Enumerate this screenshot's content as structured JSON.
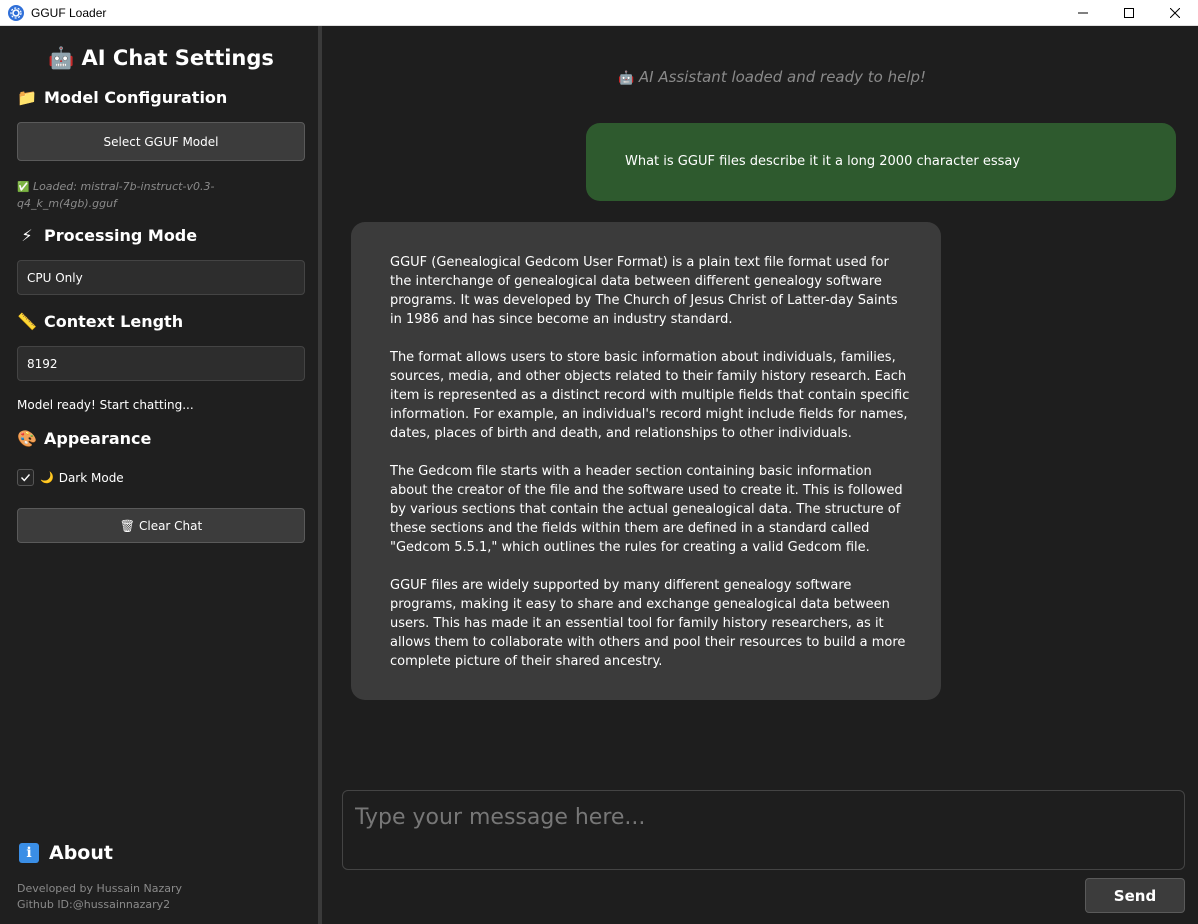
{
  "window": {
    "title": "GGUF Loader"
  },
  "sidebar": {
    "heading": "AI Chat Settings",
    "heading_icon": "🤖",
    "model_config": {
      "icon": "📁",
      "title": "Model Configuration",
      "select_button": "Select GGUF Model",
      "loaded_icon": "✅",
      "loaded_text": "Loaded: mistral-7b-instruct-v0.3-q4_k_m(4gb).gguf"
    },
    "processing": {
      "icon": "⚡",
      "title": "Processing Mode",
      "value": "CPU Only"
    },
    "context": {
      "icon": "📏",
      "title": "Context Length",
      "value": "8192"
    },
    "status": "Model ready! Start chatting...",
    "appearance": {
      "icon": "🎨",
      "title": "Appearance",
      "dark_mode_icon": "🌙",
      "dark_mode_label": "Dark Mode",
      "dark_mode_checked": true
    },
    "clear_button_icon": "🗑",
    "clear_button": "Clear Chat",
    "about": {
      "icon": "i",
      "title": "About",
      "developer": "Developed by Hussain Nazary",
      "github": "Github ID:@hussainnazary2"
    }
  },
  "chat": {
    "system_icon": "🤖",
    "system_message": "AI Assistant loaded and ready to help!",
    "user_message": "What is GGUF files describe it it a long 2000 character essay",
    "bot_paragraphs": [
      "GGUF (Genealogical Gedcom User Format) is a plain text file format used for the interchange of genealogical data between different genealogy software programs. It was developed by The Church of Jesus Christ of Latter-day Saints in 1986 and has since become an industry standard.",
      "The format allows users to store basic information about individuals, families, sources, media, and other objects related to their family history research. Each item is represented as a distinct record with multiple fields that contain specific information. For example, an individual's record might include fields for names, dates, places of birth and death, and relationships to other individuals.",
      "The Gedcom file starts with a header section containing basic information about the creator of the file and the software used to create it. This is followed by various sections that contain the actual genealogical data. The structure of these sections and the fields within them are defined in a standard called \"Gedcom 5.5.1,\" which outlines the rules for creating a valid Gedcom file.",
      "GGUF files are widely supported by many different genealogy software programs, making it easy to share and exchange genealogical data between users. This has made it an essential tool for family history researchers, as it allows them to collaborate with others and pool their resources to build a more complete picture of their shared ancestry."
    ],
    "input_placeholder": "Type your message here...",
    "send_button": "Send"
  },
  "colors": {
    "sidebar_bg": "#1f1f1f",
    "chat_bg": "#1e1e1e",
    "user_bubble": "#2e5a2e",
    "bot_bubble": "#3b3b3b"
  }
}
